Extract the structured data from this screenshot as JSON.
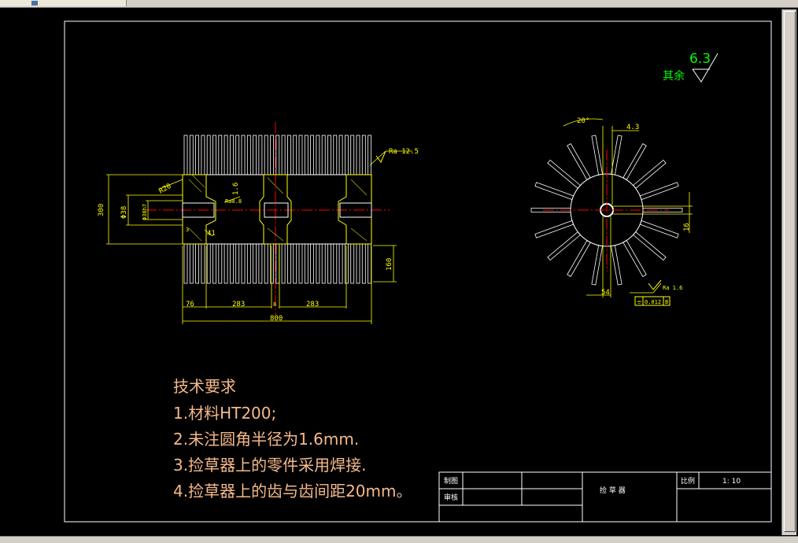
{
  "surface_finish_note": {
    "label": "其余",
    "value": "6.3"
  },
  "front_view": {
    "roughness_top": "Ra 12.5",
    "dimensions": {
      "radius": "R20",
      "height_total": "300",
      "shaft_dia": "Φ38",
      "bore_dia": "Φ38h7",
      "wall": "1.6",
      "bore_ra": "Ra0.8",
      "gap": "41",
      "small": "3",
      "tooth_len": "160",
      "left_end": "76",
      "span_1": "283",
      "span_2": "283",
      "mid": "8",
      "overall": "800"
    }
  },
  "side_view": {
    "angle": "20°",
    "tooth_width": "4.3",
    "slot": "16",
    "hub_offset": "54",
    "roughness": "Ra 1.6",
    "tolerance_symbol": "⌯",
    "tolerance_value": "0.012",
    "datum": "B"
  },
  "tech_requirements": {
    "title": "技术要求",
    "items": [
      "1.材料HT200;",
      "2.未注圆角半径为1.6mm.",
      "3.捡草器上的零件采用焊接.",
      "4.捡草器上的齿与齿间距20mm。"
    ]
  },
  "title_block": {
    "drawn_label": "制图",
    "checked_label": "审核",
    "part_name": "捡  草  器",
    "scale_label": "比例",
    "scale_value": "1: 10"
  },
  "colors": {
    "yellow": "#ffff00",
    "white": "#ffffff",
    "red": "#ff0000",
    "green": "#00ff00",
    "text_orange": "#f5b98a"
  }
}
